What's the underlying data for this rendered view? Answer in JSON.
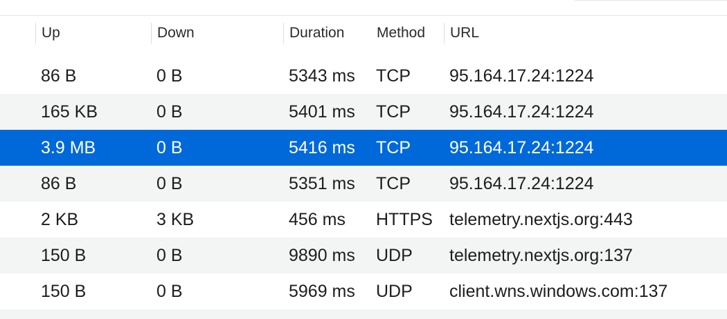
{
  "columns": {
    "up": "Up",
    "down": "Down",
    "duration": "Duration",
    "method": "Method",
    "url": "URL"
  },
  "rows": [
    {
      "up": "86 B",
      "down": "0 B",
      "duration": "5343 ms",
      "method": "TCP",
      "url": "95.164.17.24:1224"
    },
    {
      "up": "165 KB",
      "down": "0 B",
      "duration": "5401 ms",
      "method": "TCP",
      "url": "95.164.17.24:1224"
    },
    {
      "up": "3.9 MB",
      "down": "0 B",
      "duration": "5416 ms",
      "method": "TCP",
      "url": "95.164.17.24:1224"
    },
    {
      "up": "86 B",
      "down": "0 B",
      "duration": "5351 ms",
      "method": "TCP",
      "url": "95.164.17.24:1224"
    },
    {
      "up": "2 KB",
      "down": "3 KB",
      "duration": "456 ms",
      "method": "HTTPS",
      "url": "telemetry.nextjs.org:443"
    },
    {
      "up": "150 B",
      "down": "0 B",
      "duration": "9890 ms",
      "method": "UDP",
      "url": "telemetry.nextjs.org:137"
    },
    {
      "up": "150 B",
      "down": "0 B",
      "duration": "5969 ms",
      "method": "UDP",
      "url": "client.wns.windows.com:137"
    }
  ],
  "selected_row": 2,
  "colors": {
    "selection": "#0069d9",
    "alt_row": "#f3f4f4"
  }
}
